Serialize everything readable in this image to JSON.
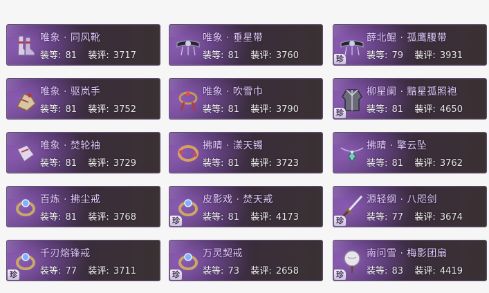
{
  "rare_label": "珍",
  "level_label": "装等:",
  "score_label": "装评:",
  "items": [
    {
      "name": "唯象 · 同风靴",
      "level": "81",
      "score": "3717",
      "rare": false,
      "icon": "boots-icon"
    },
    {
      "name": "唯象 · 垂星带",
      "level": "81",
      "score": "3760",
      "rare": false,
      "icon": "belt-icon"
    },
    {
      "name": "薛北鲲 · 孤鹰腰带",
      "level": "79",
      "score": "3931",
      "rare": true,
      "icon": "belt-icon"
    },
    {
      "name": "唯象 · 驱岚手",
      "level": "81",
      "score": "3752",
      "rare": false,
      "icon": "gauntlet-icon"
    },
    {
      "name": "唯象 · 吹雪巾",
      "level": "81",
      "score": "3790",
      "rare": false,
      "icon": "headband-icon"
    },
    {
      "name": "柳星阑 · 黯星孤照袍",
      "level": "81",
      "score": "4650",
      "rare": true,
      "icon": "robe-icon"
    },
    {
      "name": "唯象 · 焚轮袖",
      "level": "81",
      "score": "3729",
      "rare": false,
      "icon": "bracer-icon"
    },
    {
      "name": "拂晴 · 漾天镯",
      "level": "81",
      "score": "3723",
      "rare": false,
      "icon": "bracelet-icon"
    },
    {
      "name": "拂晴 · 擎云坠",
      "level": "81",
      "score": "3762",
      "rare": false,
      "icon": "pendant-icon"
    },
    {
      "name": "百炼 · 拂尘戒",
      "level": "81",
      "score": "3768",
      "rare": false,
      "icon": "ring-icon"
    },
    {
      "name": "皮影戏 · 焚天戒",
      "level": "81",
      "score": "4173",
      "rare": true,
      "icon": "ring-icon"
    },
    {
      "name": "源轻纲 · 八咫剑",
      "level": "77",
      "score": "3674",
      "rare": true,
      "icon": "sword-icon"
    },
    {
      "name": "千刃熔锋戒",
      "level": "77",
      "score": "3711",
      "rare": true,
      "icon": "ring-icon"
    },
    {
      "name": "万灵契戒",
      "level": "73",
      "score": "2658",
      "rare": true,
      "icon": "ring-icon"
    },
    {
      "name": "南问雪 · 梅影团扇",
      "level": "83",
      "score": "4419",
      "rare": true,
      "icon": "fan-icon"
    }
  ],
  "colors": {
    "name": "#e2c8ff",
    "stats": "#ffffff",
    "card_left": "#6d4a8c",
    "card_right": "#3a3133"
  }
}
